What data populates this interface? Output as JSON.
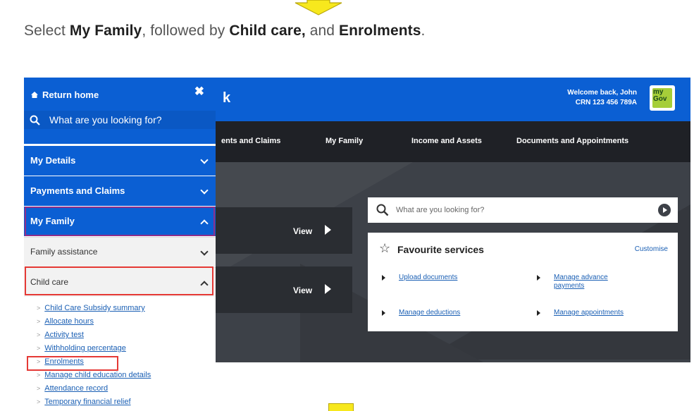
{
  "instruction": {
    "prefix": "Select ",
    "b1": "My Family",
    "mid1": ",  followed by ",
    "b2": "Child care,",
    "mid2": " and ",
    "b3": "Enrolments",
    "suffix": "."
  },
  "colors": {
    "arrow_fill": "#f7e81d",
    "header_blue": "#0b5fd3",
    "nav_dark": "#1f2126",
    "highlight_red": "#e53935"
  },
  "header": {
    "partial_brand": "k",
    "welcome_line1": "Welcome back, John",
    "welcome_line2": "CRN 123 456 789A",
    "logo_text": "my Gov"
  },
  "nav": {
    "items": [
      "ents and Claims",
      "My Family",
      "Income and Assets",
      "Documents and Appointments"
    ]
  },
  "hero": {
    "view_label": "View",
    "search_placeholder": "What are you looking for?",
    "favourites_title": "Favourite services",
    "customise": "Customise",
    "links": [
      "Upload documents",
      "Manage advance payments",
      "Manage deductions",
      "Manage appointments"
    ]
  },
  "drawer": {
    "return_home": "Return home",
    "close_symbol": "✖",
    "search_text": "What are you looking for?",
    "sections": [
      "My Details",
      "Payments and Claims",
      "My Family"
    ],
    "subsections": [
      "Family assistance",
      "Child care"
    ],
    "child_care_links": [
      "Child Care Subsidy summary",
      "Allocate hours",
      "Activity test",
      "Withholding percentage",
      "Enrolments",
      "Manage child education details",
      "Attendance record",
      "Temporary financial relief"
    ]
  }
}
